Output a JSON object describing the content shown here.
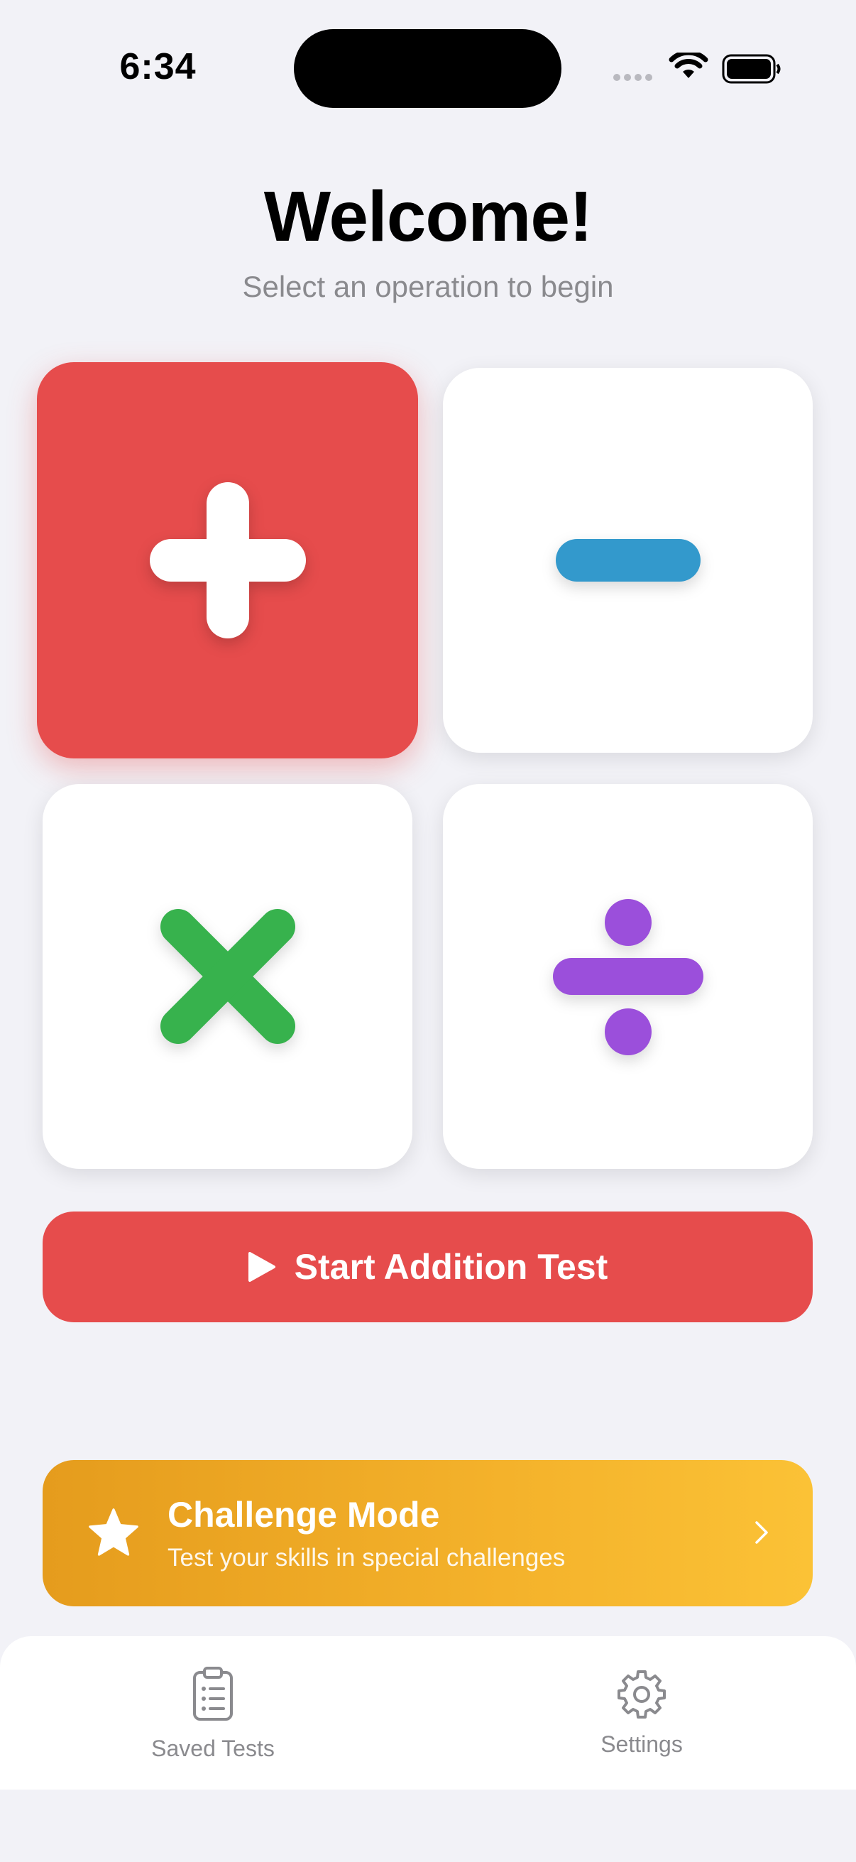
{
  "status_bar": {
    "time": "6:34"
  },
  "header": {
    "title": "Welcome!",
    "subtitle": "Select an operation to begin"
  },
  "operations": [
    {
      "name": "Addition",
      "icon": "plus-icon",
      "color": "#e64c4c",
      "selected": true
    },
    {
      "name": "Subtraction",
      "icon": "minus-icon",
      "color": "#3399cc",
      "selected": false
    },
    {
      "name": "Multiplication",
      "icon": "multiply-icon",
      "color": "#37b24d",
      "selected": false
    },
    {
      "name": "Division",
      "icon": "divide-icon",
      "color": "#9b4fdb",
      "selected": false
    }
  ],
  "start_button": {
    "label": "Start Addition Test",
    "icon": "play-icon",
    "color": "#e64c4c"
  },
  "challenge": {
    "title": "Challenge Mode",
    "subtitle": "Test your skills in special challenges",
    "icon": "star-icon",
    "gradient": [
      "#e59c1d",
      "#fbc236"
    ]
  },
  "tab_bar": {
    "items": [
      {
        "label": "Saved Tests",
        "icon": "clipboard-list-icon"
      },
      {
        "label": "Settings",
        "icon": "gear-icon"
      }
    ]
  }
}
